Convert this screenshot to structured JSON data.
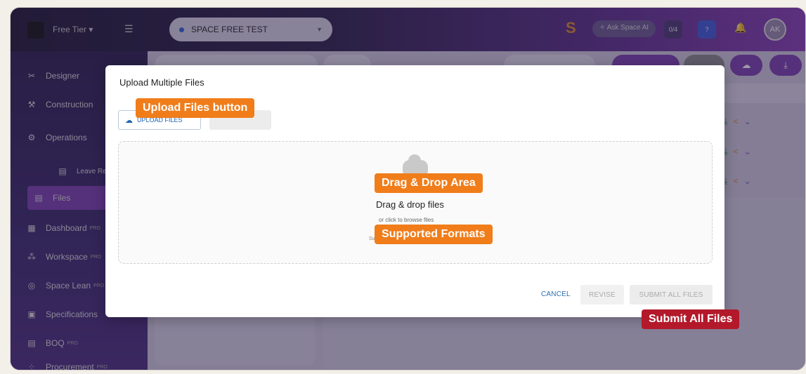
{
  "topbar": {
    "tier_label": "Free Tier",
    "project_name": "SPACE FREE TEST",
    "ask_ai_label": "Ask Space AI",
    "tasks_badge": "0/4",
    "help_label": "?",
    "avatar_initials": "AK"
  },
  "sidebar": {
    "items": [
      {
        "label": "Designer",
        "icon": "designer-icon"
      },
      {
        "label": "Construction",
        "icon": "tools-icon"
      },
      {
        "label": "Operations",
        "icon": "gear-icon"
      },
      {
        "label": "Leave Requ",
        "icon": "document-icon"
      },
      {
        "label": "Files",
        "icon": "file-icon",
        "active": true
      },
      {
        "label": "Dashboard",
        "icon": "dashboard-icon",
        "badge": "PRO"
      },
      {
        "label": "Workspace",
        "icon": "workspace-icon",
        "badge": "PRO"
      },
      {
        "label": "Space Lean",
        "icon": "lean-icon",
        "badge": "PRO"
      },
      {
        "label": "Specifications",
        "icon": "spec-icon"
      },
      {
        "label": "BOQ",
        "icon": "boq-icon",
        "badge": "PRO"
      },
      {
        "label": "Procurement",
        "icon": "procurement-icon",
        "badge": "PRO"
      }
    ]
  },
  "modal": {
    "title": "Upload Multiple Files",
    "upload_button_label": "UPLOAD FILES",
    "dropzone": {
      "main_text": "Drag & drop files",
      "sub_text": "or click to browse files",
      "formats_text": "Supp"
    },
    "footer": {
      "cancel": "CANCEL",
      "revise": "REVISE",
      "submit_all": "SUBMIT ALL FILES"
    }
  },
  "callouts": {
    "upload_files": "Upload Files button",
    "drag_drop": "Drag & Drop Area",
    "supported_formats": "Supported Formats",
    "submit_all": "Submit All Files"
  },
  "colors": {
    "callout_orange": "#f07d1a",
    "callout_red": "#b3192a",
    "sidebar_active": "#7a3fb0",
    "link_blue": "#2a6fb5"
  }
}
